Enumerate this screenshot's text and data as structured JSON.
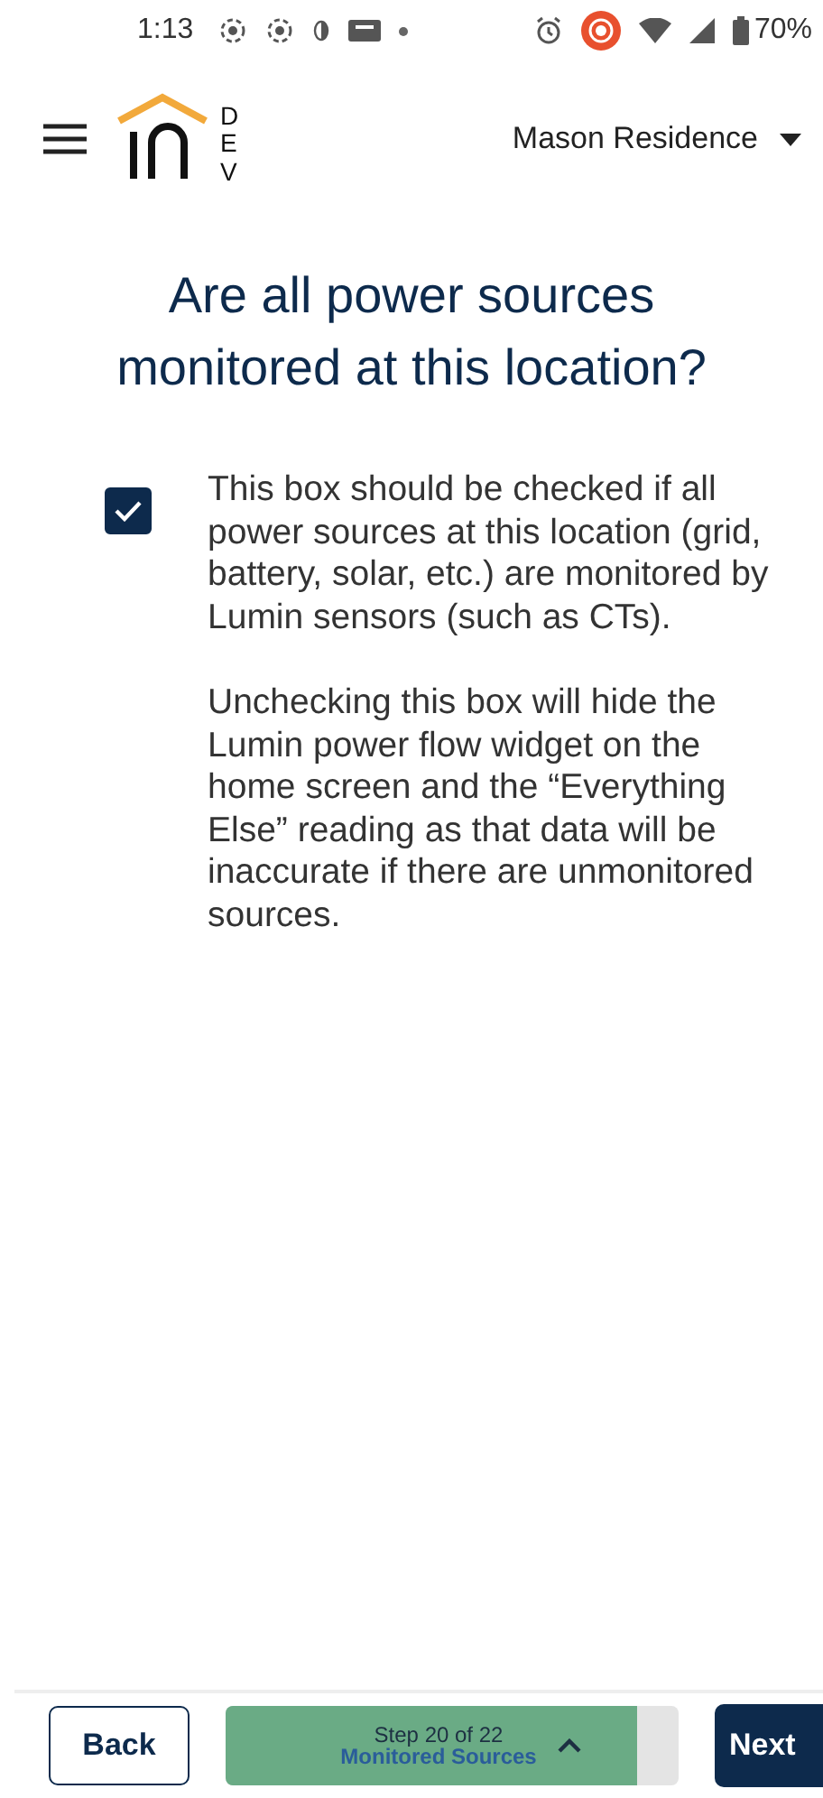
{
  "status_bar": {
    "time": "1:13",
    "battery": "70%"
  },
  "header": {
    "logo_tag": "DEV",
    "location": "Mason Residence"
  },
  "title": "Are all power sources monitored at this location?",
  "option": {
    "checked": true,
    "paragraphs": [
      "This box should be checked if all power sources at this location (grid, battery, solar, etc.) are monitored by Lumin sensors (such as CTs).",
      "Unchecking this box will hide the Lumin power flow widget on the home screen and the “Everything Else” reading as that data will be inaccurate if there are unmonitored sources."
    ]
  },
  "footer": {
    "back": "Back",
    "step": "Step 20 of 22",
    "step_name": "Monitored Sources",
    "level": 0.91,
    "next": "Next"
  }
}
